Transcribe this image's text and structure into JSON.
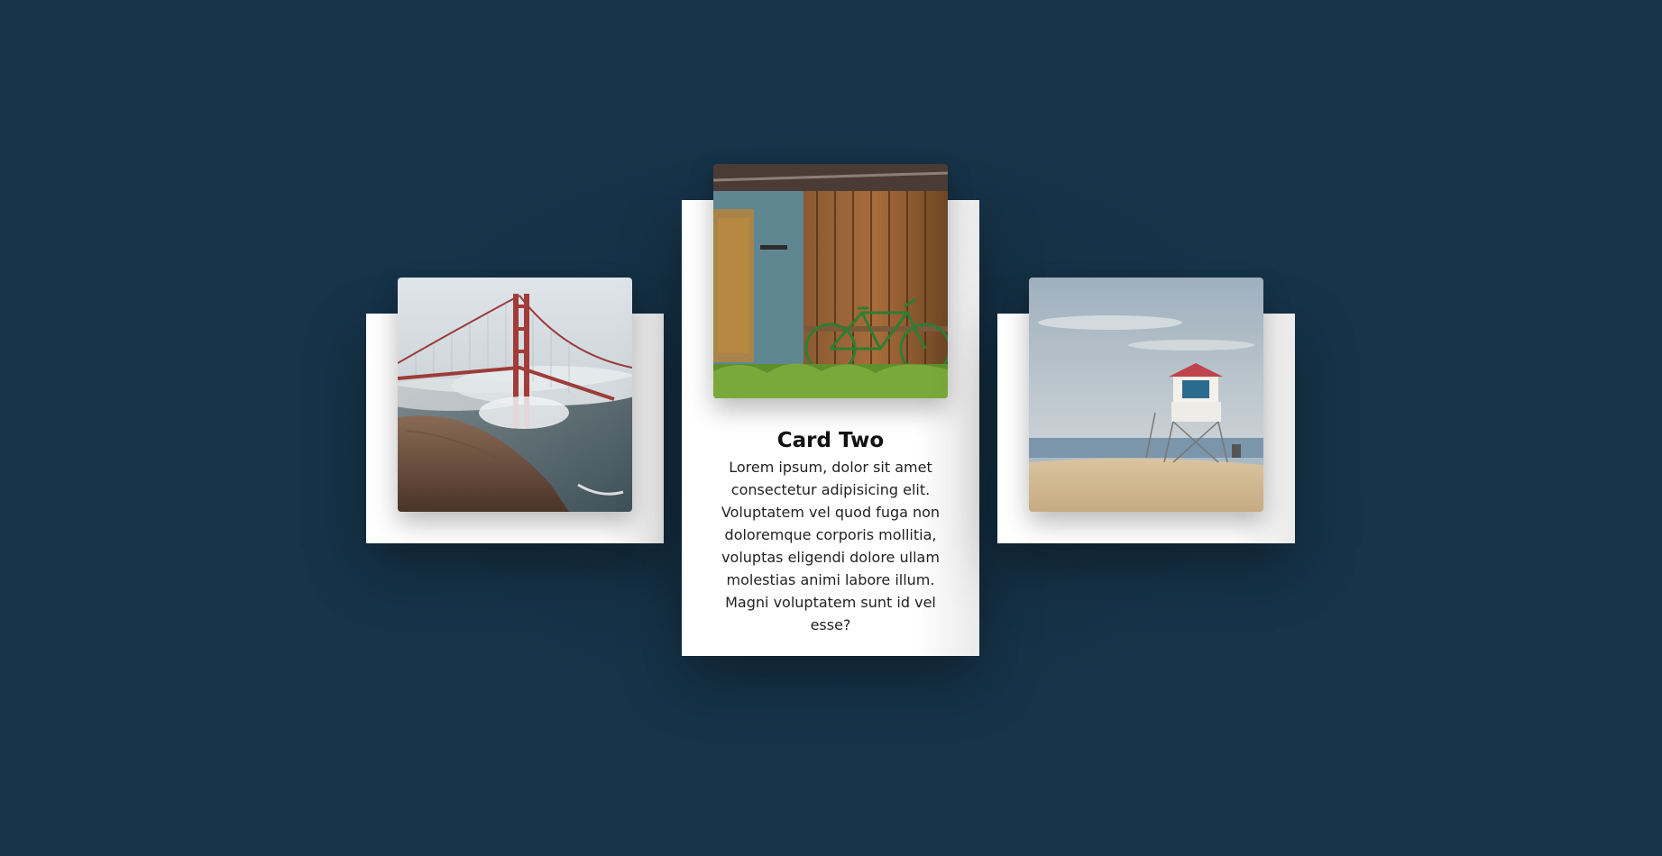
{
  "colors": {
    "background": "#17344b",
    "card": "#ffffff",
    "title": "#111111",
    "text": "#222222"
  },
  "cards": [
    {
      "image": "golden-gate-bridge-in-fog"
    },
    {
      "image": "old-wooden-shed-with-green-bicycle",
      "title": "Card Two",
      "text": "Lorem ipsum, dolor sit amet consectetur adipisicing elit. Voluptatem vel quod fuga non doloremque corporis mollitia, voluptas eligendi dolore ullam molestias animi labore illum. Magni voluptatem sunt id vel esse?"
    },
    {
      "image": "lifeguard-tower-on-beach"
    }
  ]
}
